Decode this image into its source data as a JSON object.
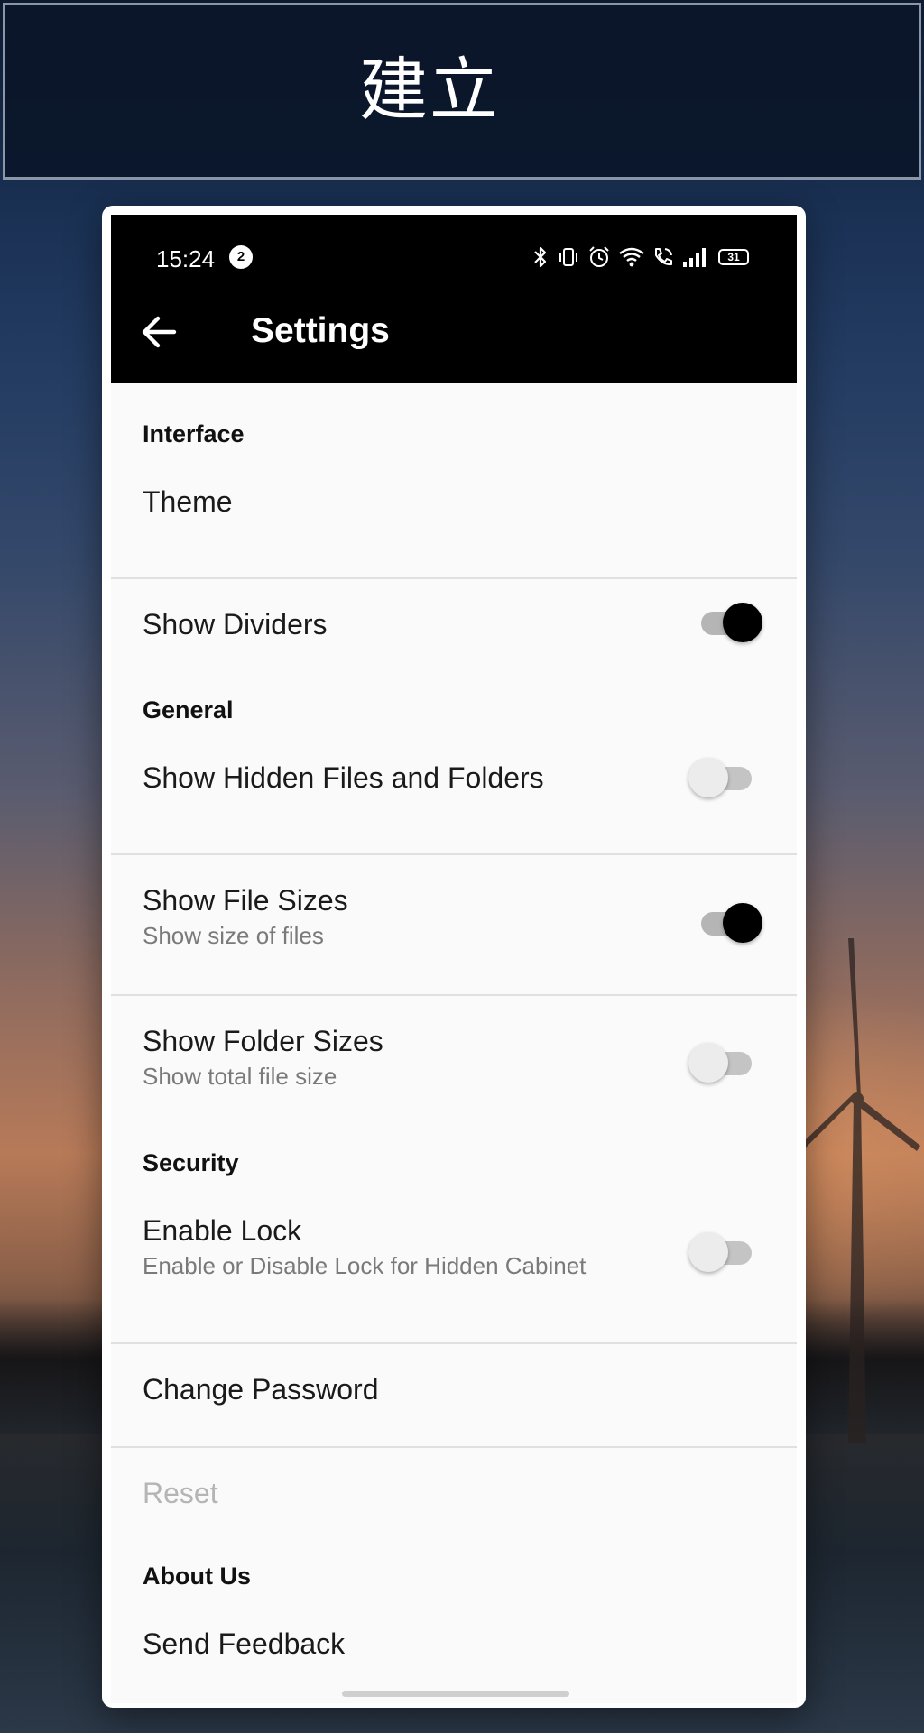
{
  "banner": {
    "title": "建立"
  },
  "status_bar": {
    "time": "15:24",
    "notification_count": "2",
    "battery": "31",
    "icons": [
      "bluetooth-icon",
      "vibrate-icon",
      "alarm-icon",
      "wifi-icon",
      "call-icon",
      "signal-icon",
      "battery-icon"
    ]
  },
  "appbar": {
    "back_icon": "arrow-left-icon",
    "title": "Settings"
  },
  "sections": {
    "interface": {
      "header": "Interface",
      "theme": "Theme",
      "show_dividers": {
        "label": "Show Dividers",
        "enabled": true
      }
    },
    "general": {
      "header": "General",
      "show_hidden": {
        "label": "Show Hidden Files and Folders",
        "enabled": false
      },
      "show_file_sizes": {
        "label": "Show File Sizes",
        "summary": "Show size of files",
        "enabled": true
      },
      "show_folder_sizes": {
        "label": "Show Folder Sizes",
        "summary": "Show total file size",
        "enabled": false
      }
    },
    "security": {
      "header": "Security",
      "enable_lock": {
        "label": "Enable Lock",
        "summary": "Enable or Disable Lock for Hidden Cabinet",
        "enabled": false
      },
      "change_password": "Change Password",
      "reset": {
        "label": "Reset",
        "disabled": true
      }
    },
    "about": {
      "header": "About Us",
      "send_feedback": "Send Feedback"
    }
  },
  "colors": {
    "appbar": "#000000",
    "switch_on_knob": "#000000",
    "switch_off_knob": "#ececec",
    "disabled_text": "#b5b5b5",
    "summary_text": "#7a7a7a"
  }
}
